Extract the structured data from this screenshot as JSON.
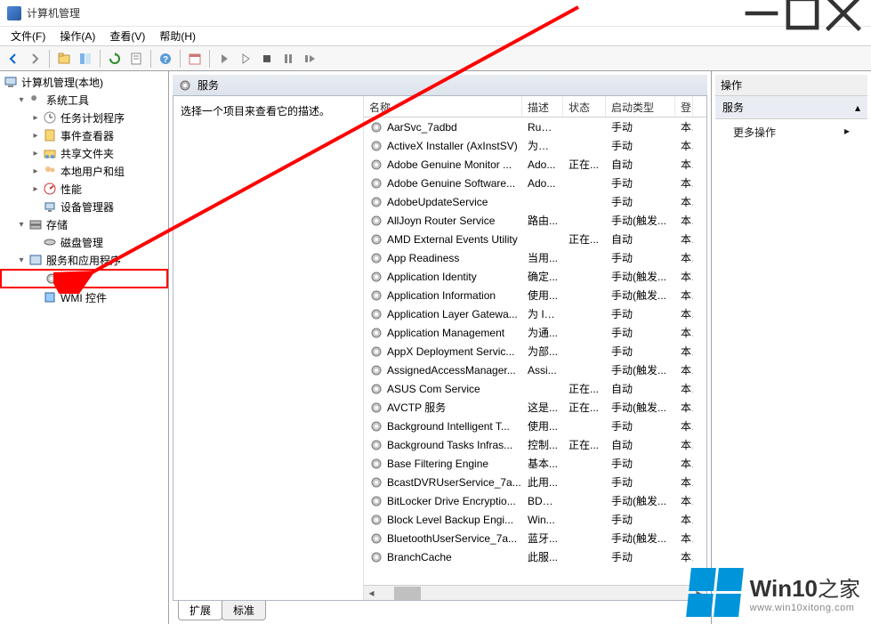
{
  "window": {
    "title": "计算机管理"
  },
  "menu": {
    "file": "文件(F)",
    "action": "操作(A)",
    "view": "查看(V)",
    "help": "帮助(H)"
  },
  "tree": {
    "root": "计算机管理(本地)",
    "system_tools": "系统工具",
    "task_scheduler": "任务计划程序",
    "event_viewer": "事件查看器",
    "shared_folders": "共享文件夹",
    "local_users": "本地用户和组",
    "performance": "性能",
    "device_manager": "设备管理器",
    "storage": "存储",
    "disk_mgmt": "磁盘管理",
    "services_apps": "服务和应用程序",
    "services": "服务",
    "wmi": "WMI 控件"
  },
  "center": {
    "header": "服务",
    "description": "选择一个项目来查看它的描述。",
    "columns": {
      "name": "名称",
      "desc": "描述",
      "state": "状态",
      "start": "启动类型",
      "logon": "登"
    },
    "rows": [
      {
        "name": "AarSvc_7adbd",
        "desc": "Runt...",
        "state": "",
        "start": "手动",
        "logon": "本"
      },
      {
        "name": "ActiveX Installer (AxInstSV)",
        "desc": "为从 ...",
        "state": "",
        "start": "手动",
        "logon": "本"
      },
      {
        "name": "Adobe Genuine Monitor ...",
        "desc": "Ado...",
        "state": "正在...",
        "start": "自动",
        "logon": "本"
      },
      {
        "name": "Adobe Genuine Software...",
        "desc": "Ado...",
        "state": "",
        "start": "手动",
        "logon": "本"
      },
      {
        "name": "AdobeUpdateService",
        "desc": "",
        "state": "",
        "start": "手动",
        "logon": "本"
      },
      {
        "name": "AllJoyn Router Service",
        "desc": "路由...",
        "state": "",
        "start": "手动(触发...",
        "logon": "本"
      },
      {
        "name": "AMD External Events Utility",
        "desc": "",
        "state": "正在...",
        "start": "自动",
        "logon": "本"
      },
      {
        "name": "App Readiness",
        "desc": "当用...",
        "state": "",
        "start": "手动",
        "logon": "本"
      },
      {
        "name": "Application Identity",
        "desc": "确定...",
        "state": "",
        "start": "手动(触发...",
        "logon": "本"
      },
      {
        "name": "Application Information",
        "desc": "使用...",
        "state": "",
        "start": "手动(触发...",
        "logon": "本"
      },
      {
        "name": "Application Layer Gatewa...",
        "desc": "为 In...",
        "state": "",
        "start": "手动",
        "logon": "本"
      },
      {
        "name": "Application Management",
        "desc": "为通...",
        "state": "",
        "start": "手动",
        "logon": "本"
      },
      {
        "name": "AppX Deployment Servic...",
        "desc": "为部...",
        "state": "",
        "start": "手动",
        "logon": "本"
      },
      {
        "name": "AssignedAccessManager...",
        "desc": "Assi...",
        "state": "",
        "start": "手动(触发...",
        "logon": "本"
      },
      {
        "name": "ASUS Com Service",
        "desc": "",
        "state": "正在...",
        "start": "自动",
        "logon": "本"
      },
      {
        "name": "AVCTP 服务",
        "desc": "这是...",
        "state": "正在...",
        "start": "手动(触发...",
        "logon": "本"
      },
      {
        "name": "Background Intelligent T...",
        "desc": "使用...",
        "state": "",
        "start": "手动",
        "logon": "本"
      },
      {
        "name": "Background Tasks Infras...",
        "desc": "控制...",
        "state": "正在...",
        "start": "自动",
        "logon": "本"
      },
      {
        "name": "Base Filtering Engine",
        "desc": "基本...",
        "state": "",
        "start": "手动",
        "logon": "本"
      },
      {
        "name": "BcastDVRUserService_7a...",
        "desc": "此用...",
        "state": "",
        "start": "手动",
        "logon": "本"
      },
      {
        "name": "BitLocker Drive Encryptio...",
        "desc": "BDE...",
        "state": "",
        "start": "手动(触发...",
        "logon": "本"
      },
      {
        "name": "Block Level Backup Engi...",
        "desc": "Win...",
        "state": "",
        "start": "手动",
        "logon": "本"
      },
      {
        "name": "BluetoothUserService_7a...",
        "desc": "蓝牙...",
        "state": "",
        "start": "手动(触发...",
        "logon": "本"
      },
      {
        "name": "BranchCache",
        "desc": "此服...",
        "state": "",
        "start": "手动",
        "logon": "本"
      }
    ],
    "tabs": {
      "extended": "扩展",
      "standard": "标准"
    }
  },
  "actions": {
    "header": "操作",
    "sub": "服务",
    "more": "更多操作"
  },
  "watermark": {
    "brand_en": "Win10",
    "brand_zh": "之家",
    "url": "www.win10xitong.com"
  }
}
